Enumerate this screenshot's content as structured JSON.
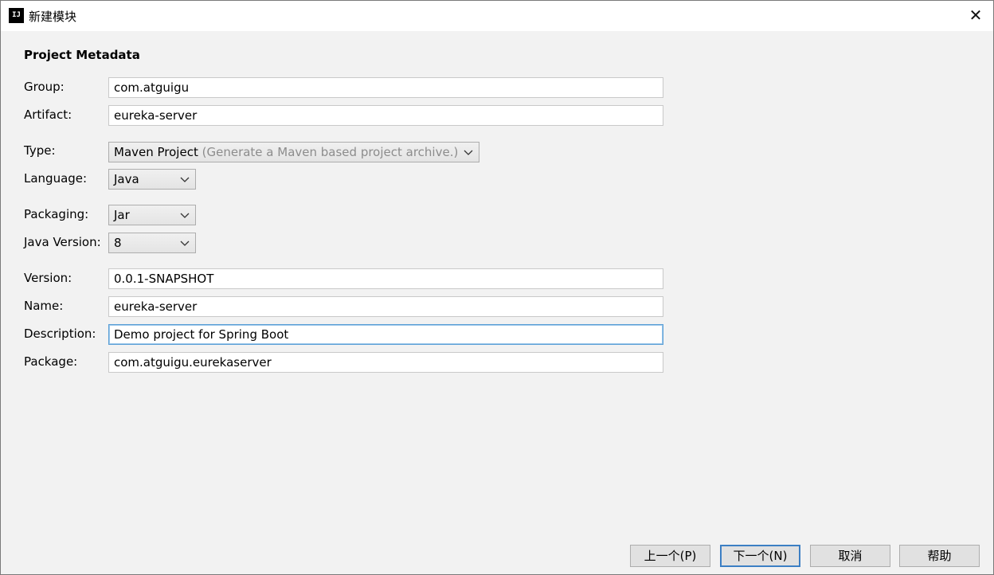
{
  "window": {
    "title": "新建模块",
    "app_icon": "intellij-idea-icon",
    "close_glyph": "✕"
  },
  "section": {
    "title": "Project Metadata"
  },
  "fields": {
    "group": {
      "label": "Group:",
      "value": "com.atguigu"
    },
    "artifact": {
      "label": "Artifact:",
      "value": "eureka-server"
    },
    "type": {
      "label": "Type:",
      "value": "Maven Project",
      "hint": "(Generate a Maven based project archive.)"
    },
    "language": {
      "label": "Language:",
      "value": "Java"
    },
    "packaging": {
      "label": "Packaging:",
      "value": "Jar"
    },
    "java_version": {
      "label": "Java Version:",
      "value": "8"
    },
    "version": {
      "label": "Version:",
      "value": "0.0.1-SNAPSHOT"
    },
    "name": {
      "label": "Name:",
      "value": "eureka-server"
    },
    "description": {
      "label": "Description:",
      "value": "Demo project for Spring Boot"
    },
    "package": {
      "label": "Package:",
      "value": "com.atguigu.eurekaserver"
    }
  },
  "buttons": {
    "previous": "上一个(P)",
    "next": "下一个(N)",
    "cancel": "取消",
    "help": "帮助"
  },
  "colors": {
    "focus_border": "#5a9fd6",
    "default_button_border": "#3c7fc4"
  }
}
